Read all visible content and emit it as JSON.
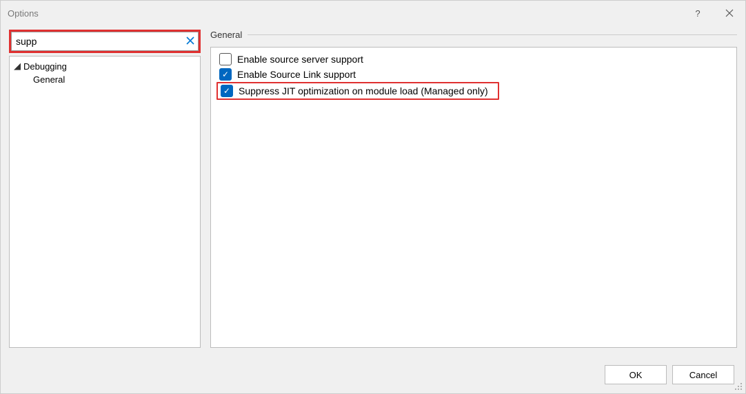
{
  "dialog": {
    "title": "Options"
  },
  "search": {
    "value": "supp"
  },
  "tree": {
    "debugging": "Debugging",
    "general": "General"
  },
  "section": {
    "title": "General"
  },
  "options": {
    "source_server": {
      "label": "Enable source server support",
      "checked": false
    },
    "source_link": {
      "label": "Enable Source Link support",
      "checked": true
    },
    "suppress_jit": {
      "label": "Suppress JIT optimization on module load (Managed only)",
      "checked": true
    }
  },
  "footer": {
    "ok": "OK",
    "cancel": "Cancel"
  },
  "highlights": {
    "search_box": true,
    "suppress_jit_row": true
  }
}
